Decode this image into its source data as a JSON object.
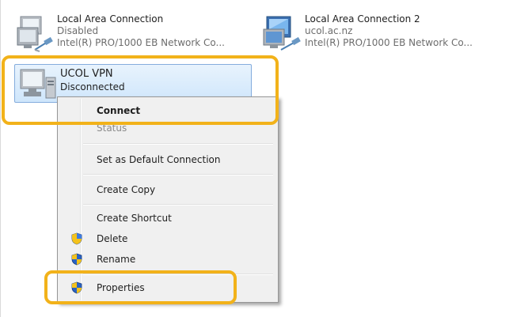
{
  "connections": [
    {
      "name": "Local Area Connection",
      "status": "Disabled",
      "adapter": "Intel(R) PRO/1000 EB Network Co..."
    },
    {
      "name": "Local Area Connection 2",
      "status": "ucol.ac.nz",
      "adapter": "Intel(R) PRO/1000 EB Network Co..."
    },
    {
      "name": "UCOL VPN",
      "status": "Disconnected"
    }
  ],
  "context_menu": {
    "items": [
      {
        "label": "Connect",
        "bold": true,
        "enabled": true,
        "shield": false
      },
      {
        "label": "Status",
        "bold": false,
        "enabled": false,
        "shield": false
      },
      {
        "label": "Set as Default Connection",
        "bold": false,
        "enabled": true,
        "shield": false
      },
      {
        "label": "Create Copy",
        "bold": false,
        "enabled": true,
        "shield": false
      },
      {
        "label": "Create Shortcut",
        "bold": false,
        "enabled": true,
        "shield": false
      },
      {
        "label": "Delete",
        "bold": false,
        "enabled": true,
        "shield": true
      },
      {
        "label": "Rename",
        "bold": false,
        "enabled": true,
        "shield": true
      },
      {
        "label": "Properties",
        "bold": false,
        "enabled": true,
        "shield": true
      }
    ]
  },
  "highlight_color": "#f2b21a",
  "selection_color": "#cfe6fb",
  "icons": [
    "network-computer-icon",
    "network-cable-icon",
    "vpn-computer-icon",
    "uac-shield-icon"
  ]
}
